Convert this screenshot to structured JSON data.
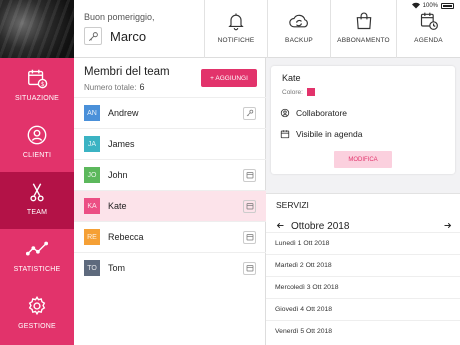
{
  "sidebar": {
    "items": [
      {
        "label": "SITUAZIONE",
        "icon": "calendar-dollar-icon"
      },
      {
        "label": "CLIENTI",
        "icon": "user-circle-icon"
      },
      {
        "label": "TEAM",
        "icon": "scissors-icon"
      },
      {
        "label": "STATISTICHE",
        "icon": "line-chart-icon"
      },
      {
        "label": "GESTIONE",
        "icon": "gear-icon"
      }
    ],
    "active": "TEAM"
  },
  "header": {
    "greeting": "Buon pomeriggio,",
    "user_name": "Marco",
    "buttons": [
      {
        "label": "NOTIFICHE",
        "icon": "bell-icon"
      },
      {
        "label": "BACKUP",
        "icon": "cloud-sync-icon"
      },
      {
        "label": "ABBONAMENTO",
        "icon": "shopping-bag-icon"
      },
      {
        "label": "AGENDA",
        "icon": "calendar-clock-icon"
      }
    ],
    "status": {
      "battery": "100%"
    }
  },
  "team": {
    "title": "Membri del team",
    "count_label": "Numero totale:",
    "count": "6",
    "add_label": "+ AGGIUNGI",
    "members": [
      {
        "initials": "AN",
        "name": "Andrew",
        "color": "#4a90d9",
        "action": "key-icon"
      },
      {
        "initials": "JA",
        "name": "James",
        "color": "#3bb3c3",
        "action": ""
      },
      {
        "initials": "JO",
        "name": "John",
        "color": "#5cb85c",
        "action": "calendar-icon"
      },
      {
        "initials": "KA",
        "name": "Kate",
        "color": "#ec4f84",
        "action": "calendar-icon"
      },
      {
        "initials": "RE",
        "name": "Rebecca",
        "color": "#f5a035",
        "action": "calendar-icon"
      },
      {
        "initials": "TO",
        "name": "Tom",
        "color": "#5e6a7d",
        "action": "calendar-icon"
      }
    ],
    "selected": "Kate"
  },
  "detail": {
    "name": "Kate",
    "color_label": "Colore:",
    "color": "#e2336b",
    "role": "Collaboratore",
    "visibility": "Visibile in agenda",
    "edit_label": "MODIFICA"
  },
  "services": {
    "title": "SERVIZI",
    "month": "Ottobre 2018",
    "days": [
      "Lunedì 1 Ott 2018",
      "Martedì 2 Ott 2018",
      "Mercoledì 3 Ott 2018",
      "Giovedì 4 Ott 2018",
      "Venerdì 5 Ott 2018"
    ]
  },
  "colors": {
    "accent": "#e2336b",
    "accent_dark": "#b31247",
    "accent_light": "#fbd0de"
  }
}
